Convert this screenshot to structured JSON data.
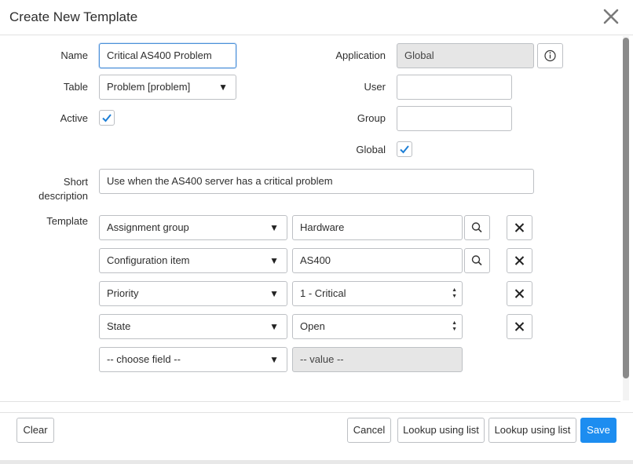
{
  "dialog": {
    "title": "Create New Template",
    "close_icon": "close-icon"
  },
  "form": {
    "name_label": "Name",
    "name_value": "Critical AS400 Problem",
    "table_label": "Table",
    "table_value": "Problem [problem]",
    "active_label": "Active",
    "active_checked": true,
    "application_label": "Application",
    "application_value": "Global",
    "user_label": "User",
    "user_value": "",
    "group_label": "Group",
    "group_value": "",
    "global_label": "Global",
    "global_checked": true,
    "short_description_label_1": "Short",
    "short_description_label_2": "description",
    "short_description_value": "Use when the AS400 server has a critical problem",
    "template_label": "Template"
  },
  "template_rows": [
    {
      "field": "Assignment group",
      "value": "Hardware",
      "value_type": "reference"
    },
    {
      "field": "Configuration item",
      "value": "AS400",
      "value_type": "reference"
    },
    {
      "field": "Priority",
      "value": "1 - Critical",
      "value_type": "choice"
    },
    {
      "field": "State",
      "value": "Open",
      "value_type": "choice"
    },
    {
      "field": "-- choose field --",
      "value": "-- value --",
      "value_type": "disabled"
    }
  ],
  "footer": {
    "clear_label": "Clear",
    "cancel_label": "Cancel",
    "lookup_label_1": "Lookup using list",
    "lookup_label_2": "Lookup using list",
    "save_label": "Save"
  },
  "colors": {
    "primary": "#1d8df0",
    "check": "#1d7fd6",
    "focus_border": "#4a90d9"
  }
}
